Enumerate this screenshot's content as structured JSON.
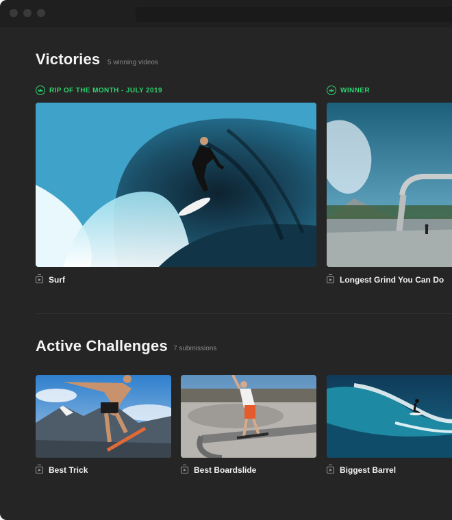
{
  "victories": {
    "title": "Victories",
    "count": "5 winning videos",
    "items": [
      {
        "badge": "RIP OF THE MONTH - JULY 2019",
        "badge_icon": "crown-icon",
        "caption": "Surf",
        "icon": "video-icon"
      },
      {
        "badge": "WINNER",
        "badge_icon": "crown-icon",
        "caption": "Longest Grind You Can Do",
        "icon": "video-icon"
      }
    ]
  },
  "challenges": {
    "title": "Active Challenges",
    "count": "7 submissions",
    "items": [
      {
        "caption": "Best Trick",
        "icon": "video-icon"
      },
      {
        "caption": "Best Boardslide",
        "icon": "video-icon"
      },
      {
        "caption": "Biggest Barrel",
        "icon": "video-icon"
      }
    ]
  },
  "colors": {
    "accent": "#2dd36f",
    "background": "#252525"
  }
}
